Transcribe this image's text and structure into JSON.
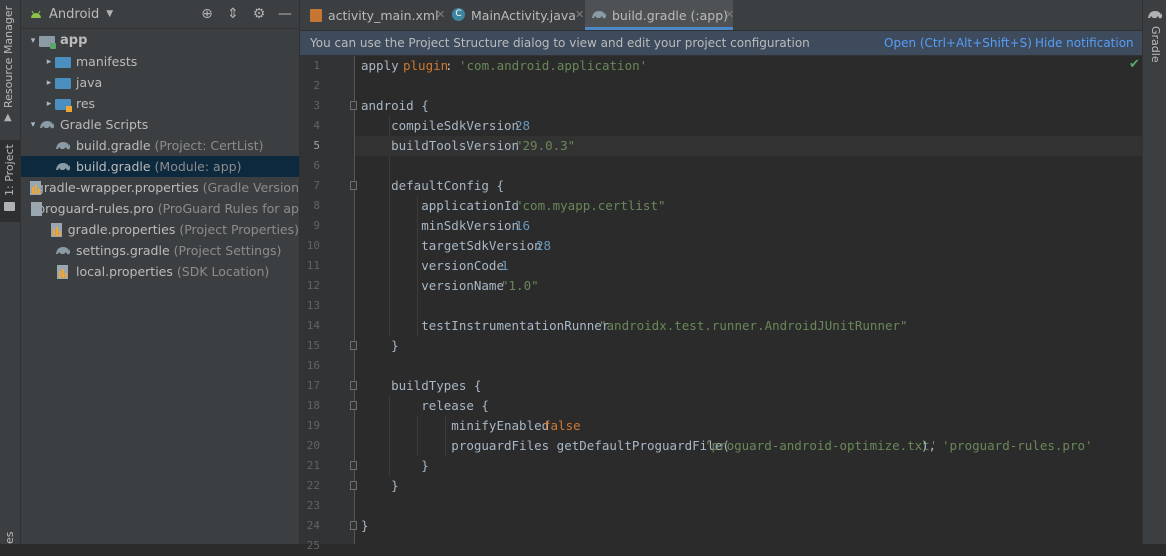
{
  "left_strip": {
    "resource_manager": "Resource Manager",
    "project_tool": "1: Project",
    "bottom_cut": "es"
  },
  "right_strip": {
    "gradle": "Gradle"
  },
  "project_panel": {
    "view_label": "Android",
    "tree": [
      {
        "label": "app",
        "hint": "",
        "icon": "app-module-icon",
        "arrow": "▾"
      },
      {
        "label": "manifests",
        "hint": "",
        "icon": "folder-icon",
        "arrow": "▸"
      },
      {
        "label": "java",
        "hint": "",
        "icon": "folder-icon",
        "arrow": "▸"
      },
      {
        "label": "res",
        "hint": "",
        "icon": "res-folder-icon",
        "arrow": "▸"
      },
      {
        "label": "Gradle Scripts",
        "hint": "",
        "icon": "gradle-icon",
        "arrow": "▾"
      },
      {
        "label": "build.gradle",
        "hint": "(Project: CertList)",
        "icon": "gradle-icon",
        "arrow": ""
      },
      {
        "label": "build.gradle",
        "hint": "(Module: app)",
        "icon": "gradle-icon",
        "arrow": ""
      },
      {
        "label": "gradle-wrapper.properties",
        "hint": "(Gradle Version",
        "icon": "properties-icon",
        "arrow": ""
      },
      {
        "label": "proguard-rules.pro",
        "hint": "(ProGuard Rules for ap",
        "icon": "file-icon",
        "arrow": ""
      },
      {
        "label": "gradle.properties",
        "hint": "(Project Properties)",
        "icon": "properties-icon",
        "arrow": ""
      },
      {
        "label": "settings.gradle",
        "hint": "(Project Settings)",
        "icon": "gradle-icon",
        "arrow": ""
      },
      {
        "label": "local.properties",
        "hint": "(SDK Location)",
        "icon": "properties-icon",
        "arrow": ""
      }
    ]
  },
  "tabs": [
    {
      "label": "activity_main.xml",
      "icon": "xml-file-icon"
    },
    {
      "label": "MainActivity.java",
      "icon": "java-class-icon"
    },
    {
      "label": "build.gradle (:app)",
      "icon": "gradle-icon"
    }
  ],
  "notification": {
    "message": "You can use the Project Structure dialog to view and edit your project configuration",
    "open_link": "Open (Ctrl+Alt+Shift+S)",
    "hide_link": "Hide notification"
  },
  "editor": {
    "line_numbers": [
      "1",
      "2",
      "3",
      "4",
      "5",
      "6",
      "7",
      "8",
      "9",
      "10",
      "11",
      "12",
      "13",
      "14",
      "15",
      "16",
      "17",
      "18",
      "19",
      "20",
      "21",
      "22",
      "23",
      "24",
      "25"
    ],
    "lines": [
      [
        {
          "t": "apply ",
          "c": "p"
        },
        {
          "t": "plugin",
          "c": "kw"
        },
        {
          "t": ": ",
          "c": "p"
        },
        {
          "t": "'com.android.application'",
          "c": "str"
        }
      ],
      [],
      [
        {
          "t": "android {",
          "c": "p"
        }
      ],
      [
        {
          "t": "    compileSdkVersion ",
          "c": "p"
        },
        {
          "t": "28",
          "c": "num"
        }
      ],
      [
        {
          "t": "    buildToolsVersion ",
          "c": "p"
        },
        {
          "t": "\"29.0.3\"",
          "c": "str"
        }
      ],
      [],
      [
        {
          "t": "    defaultConfig {",
          "c": "p"
        }
      ],
      [
        {
          "t": "        applicationId ",
          "c": "p"
        },
        {
          "t": "\"com.myapp.certlist\"",
          "c": "str"
        }
      ],
      [
        {
          "t": "        minSdkVersion ",
          "c": "p"
        },
        {
          "t": "16",
          "c": "num"
        }
      ],
      [
        {
          "t": "        targetSdkVersion ",
          "c": "p"
        },
        {
          "t": "28",
          "c": "num"
        }
      ],
      [
        {
          "t": "        versionCode ",
          "c": "p"
        },
        {
          "t": "1",
          "c": "num"
        }
      ],
      [
        {
          "t": "        versionName ",
          "c": "p"
        },
        {
          "t": "\"1.0\"",
          "c": "str"
        }
      ],
      [],
      [
        {
          "t": "        testInstrumentationRunner ",
          "c": "p"
        },
        {
          "t": "\"androidx.test.runner.AndroidJUnitRunner\"",
          "c": "str"
        }
      ],
      [
        {
          "t": "    }",
          "c": "p"
        }
      ],
      [],
      [
        {
          "t": "    buildTypes {",
          "c": "p"
        }
      ],
      [
        {
          "t": "        release {",
          "c": "p"
        }
      ],
      [
        {
          "t": "            minifyEnabled ",
          "c": "p"
        },
        {
          "t": "false",
          "c": "kw"
        }
      ],
      [
        {
          "t": "            proguardFiles getDefaultProguardFile(",
          "c": "p"
        },
        {
          "t": "'proguard-android-optimize.txt'",
          "c": "str"
        },
        {
          "t": "), ",
          "c": "p"
        },
        {
          "t": "'proguard-rules.pro'",
          "c": "str"
        }
      ],
      [
        {
          "t": "        }",
          "c": "p"
        }
      ],
      [
        {
          "t": "    }",
          "c": "p"
        }
      ],
      [],
      [
        {
          "t": "}",
          "c": "p"
        }
      ],
      []
    ]
  },
  "colors": {
    "keyword": "#cc7832",
    "string": "#6a8759",
    "number": "#6897bb",
    "plain": "#a9b7c6",
    "link": "#589df6",
    "selection": "#0d293e"
  }
}
